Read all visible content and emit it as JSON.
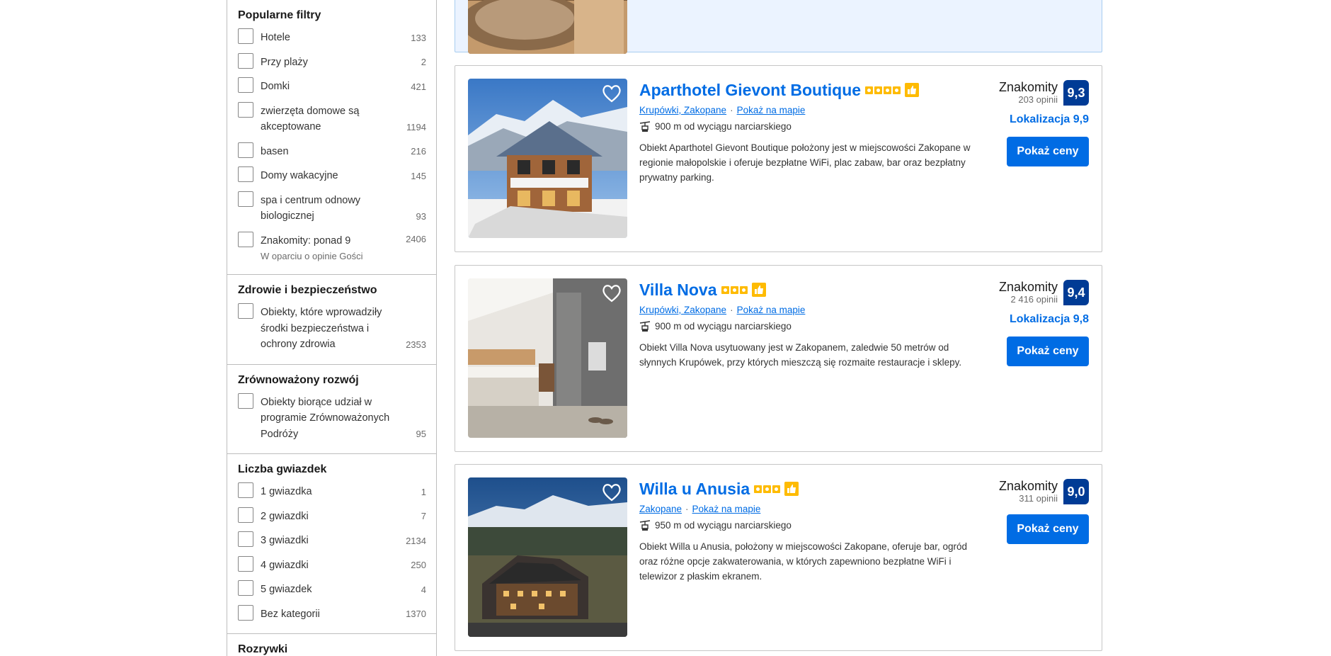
{
  "sidebar": {
    "groups": [
      {
        "title": "Popularne filtry",
        "items": [
          {
            "label": "Hotele",
            "count": "133"
          },
          {
            "label": "Przy plaży",
            "count": "2"
          },
          {
            "label": "Domki",
            "count": "421"
          },
          {
            "label": "zwierzęta domowe są akceptowane",
            "count": "1194"
          },
          {
            "label": "basen",
            "count": "216"
          },
          {
            "label": "Domy wakacyjne",
            "count": "145"
          },
          {
            "label": "spa i centrum odnowy biologicznej",
            "count": "93"
          },
          {
            "label": "Znakomity: ponad 9",
            "count": "2406",
            "sub": "W oparciu o opinie Gości"
          }
        ]
      },
      {
        "title": "Zdrowie i bezpieczeństwo",
        "items": [
          {
            "label": "Obiekty, które wprowadziły środki bezpieczeństwa i ochrony zdrowia",
            "count": "2353"
          }
        ]
      },
      {
        "title": "Zrównoważony rozwój",
        "items": [
          {
            "label": "Obiekty biorące udział w programie Zrównoważonych Podróży",
            "count": "95"
          }
        ]
      },
      {
        "title": "Liczba gwiazdek",
        "items": [
          {
            "label": "1 gwiazdka",
            "count": "1"
          },
          {
            "label": "2 gwiazdki",
            "count": "7"
          },
          {
            "label": "3 gwiazdki",
            "count": "2134"
          },
          {
            "label": "4 gwiazdki",
            "count": "250"
          },
          {
            "label": "5 gwiazdek",
            "count": "4"
          },
          {
            "label": "Bez kategorii",
            "count": "1370"
          }
        ]
      },
      {
        "title": "Rozrywki",
        "items": []
      }
    ]
  },
  "results": [
    {
      "name": "Aparthotel Gievont Boutique",
      "stars": 4,
      "location": "Krupówki, Zakopane",
      "map_link": "Pokaż na mapie",
      "distance": "900 m od wyciągu narciarskiego",
      "description": "Obiekt Aparthotel Gievont Boutique położony jest w miejscowości Zakopane w regionie małopolskie i oferuje bezpłatne WiFi, plac zabaw, bar oraz bezpłatny prywatny parking.",
      "score_label": "Znakomity",
      "reviews": "203 opinii",
      "score": "9,3",
      "location_score": "Lokalizacja 9,9",
      "button": "Pokaż ceny"
    },
    {
      "name": "Villa Nova",
      "stars": 3,
      "location": "Krupówki, Zakopane",
      "map_link": "Pokaż na mapie",
      "distance": "900 m od wyciągu narciarskiego",
      "description": "Obiekt Villa Nova usytuowany jest w Zakopanem, zaledwie 50 metrów od słynnych Krupówek, przy których mieszczą się rozmaite restauracje i sklepy.",
      "score_label": "Znakomity",
      "reviews": "2 416 opinii",
      "score": "9,4",
      "location_score": "Lokalizacja 9,8",
      "button": "Pokaż ceny"
    },
    {
      "name": "Willa u Anusia",
      "stars": 3,
      "location": "Zakopane",
      "map_link": "Pokaż na mapie",
      "distance": "950 m od wyciągu narciarskiego",
      "description": "Obiekt Willa u Anusia, położony w miejscowości Zakopane, oferuje bar, ogród oraz różne opcje zakwaterowania, w których zapewniono bezpłatne WiFi i telewizor z płaskim ekranem.",
      "score_label": "Znakomity",
      "reviews": "311 opinii",
      "score": "9,0",
      "location_score": "",
      "button": "Pokaż ceny"
    }
  ],
  "colors": {
    "link": "#006ce4",
    "score_badge": "#003b95",
    "stars": "#febb02",
    "highlight_bg": "#ebf3ff"
  },
  "icons": [
    "heart-icon",
    "ski-lift-icon",
    "thumbs-up-icon",
    "star-icon"
  ]
}
